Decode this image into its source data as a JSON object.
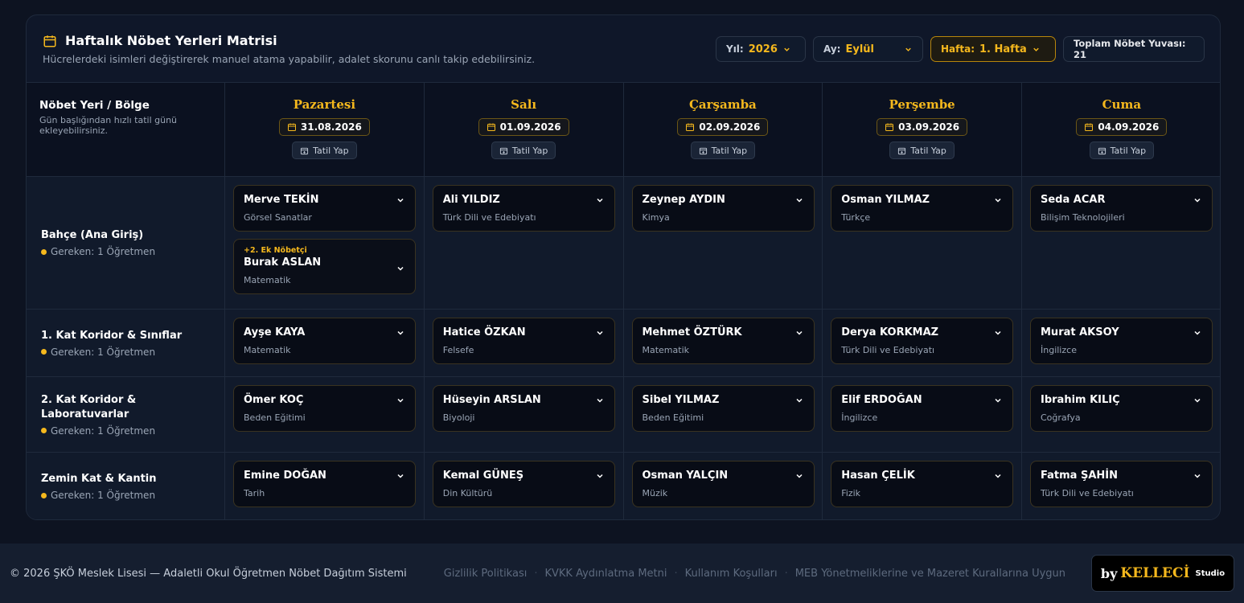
{
  "header": {
    "title": "Haftalık Nöbet Yerleri Matrisi",
    "subtitle": "Hücrelerdeki isimleri değiştirerek manuel atama yapabilir, adalet skorunu canlı takip edebilirsiniz.",
    "year_label": "Yıl:",
    "year_value": "2026",
    "month_label": "Ay:",
    "month_value": "Eylül",
    "week_label": "Hafta:",
    "week_value": "1. Hafta",
    "total_slots": "Toplam Nöbet Yuvası: 21"
  },
  "table": {
    "corner_title": "Nöbet Yeri / Bölge",
    "corner_sub": "Gün başlığından hızlı tatil günü ekleyebilirsiniz.",
    "holiday_label": "Tatil Yap",
    "days": [
      {
        "name": "Pazartesi",
        "date": "31.08.2026"
      },
      {
        "name": "Salı",
        "date": "01.09.2026"
      },
      {
        "name": "Çarşamba",
        "date": "02.09.2026"
      },
      {
        "name": "Perşembe",
        "date": "03.09.2026"
      },
      {
        "name": "Cuma",
        "date": "04.09.2026"
      }
    ],
    "zones": [
      {
        "name": "Bahçe (Ana Giriş)",
        "required": "Gereken: 1 Öğretmen",
        "extra_label": "+2. Ek Nöbetçi",
        "slots": [
          {
            "name": "Merve TEKİN",
            "branch": "Görsel Sanatlar"
          },
          {
            "name": "Ali YILDIZ",
            "branch": "Türk Dili ve Edebiyatı"
          },
          {
            "name": "Zeynep AYDIN",
            "branch": "Kimya"
          },
          {
            "name": "Osman YILMAZ",
            "branch": "Türkçe"
          },
          {
            "name": "Seda ACAR",
            "branch": "Bilişim Teknolojileri"
          }
        ],
        "extra": {
          "name": "Burak ASLAN",
          "branch": "Matematik"
        }
      },
      {
        "name": "1. Kat Koridor & Sınıflar",
        "required": "Gereken: 1 Öğretmen",
        "slots": [
          {
            "name": "Ayşe KAYA",
            "branch": "Matematik"
          },
          {
            "name": "Hatice ÖZKAN",
            "branch": "Felsefe"
          },
          {
            "name": "Mehmet ÖZTÜRK",
            "branch": "Matematik"
          },
          {
            "name": "Derya KORKMAZ",
            "branch": "Türk Dili ve Edebiyatı"
          },
          {
            "name": "Murat AKSOY",
            "branch": "İngilizce"
          }
        ]
      },
      {
        "name": "2. Kat Koridor & Laboratuvarlar",
        "required": "Gereken: 1 Öğretmen",
        "slots": [
          {
            "name": "Ömer KOÇ",
            "branch": "Beden Eğitimi"
          },
          {
            "name": "Hüseyin ARSLAN",
            "branch": "Biyoloji"
          },
          {
            "name": "Sibel YILMAZ",
            "branch": "Beden Eğitimi"
          },
          {
            "name": "Elif ERDOĞAN",
            "branch": "İngilizce"
          },
          {
            "name": "Ibrahim KILIÇ",
            "branch": "Coğrafya"
          }
        ]
      },
      {
        "name": "Zemin Kat & Kantin",
        "required": "Gereken: 1 Öğretmen",
        "slots": [
          {
            "name": "Emine DOĞAN",
            "branch": "Tarih"
          },
          {
            "name": "Kemal GÜNEŞ",
            "branch": "Din Kültürü"
          },
          {
            "name": "Osman YALÇIN",
            "branch": "Müzik"
          },
          {
            "name": "Hasan ÇELİK",
            "branch": "Fizik"
          },
          {
            "name": "Fatma ŞAHİN",
            "branch": "Türk Dili ve Edebiyatı"
          }
        ]
      }
    ]
  },
  "footer": {
    "copyright": "© 2026 ŞKÖ Meslek Lisesi — Adaletli Okul Öğretmen Nöbet Dağıtım Sistemi",
    "links": [
      "Gizlilik Politikası",
      "KVKK Aydınlatma Metni",
      "Kullanım Koşulları",
      "MEB Yönetmeliklerine ve Mazeret Kurallarına Uygun"
    ],
    "separator": "·",
    "brand_by": "by",
    "brand_name": "KELLECİ",
    "brand_suffix": "Studio"
  },
  "colors": {
    "accent": "#f5b81d",
    "background": "#0d1321",
    "panel": "#0f1729"
  },
  "icons": {
    "calendar": "calendar-icon",
    "chevron": "chevron-down-icon",
    "holiday": "calendar-plus-icon"
  }
}
